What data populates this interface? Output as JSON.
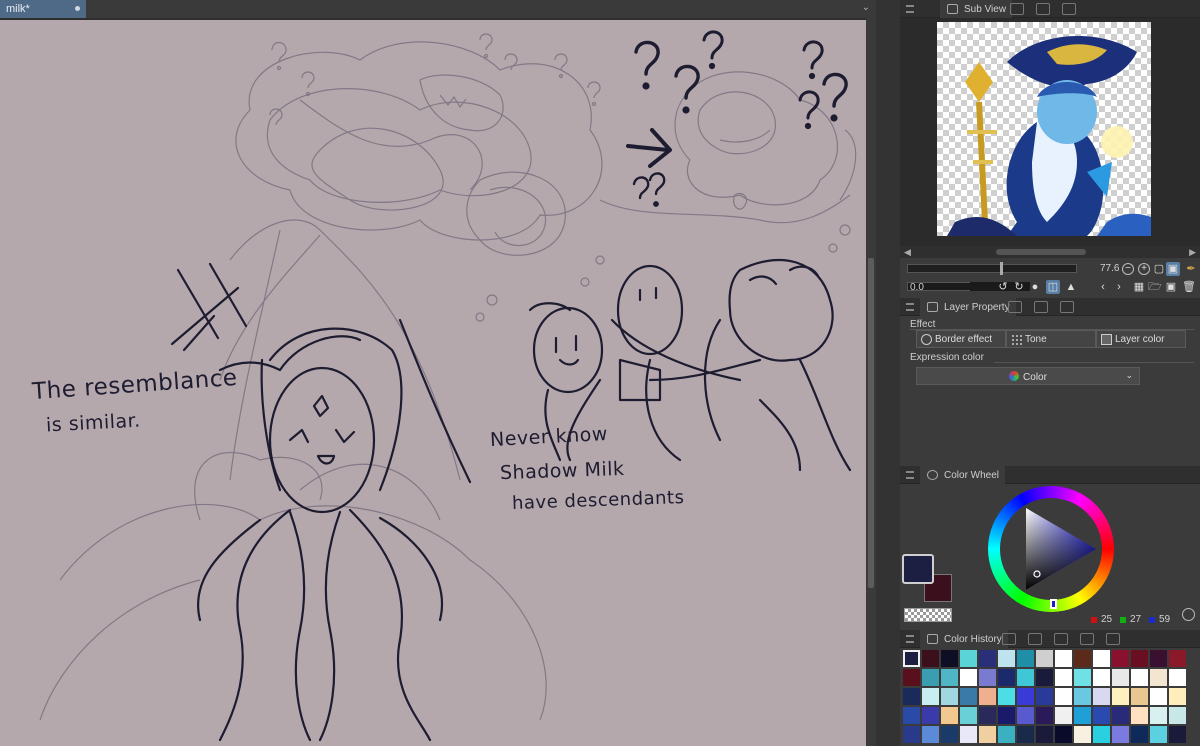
{
  "document": {
    "tab_title": "milk*"
  },
  "canvas": {
    "background": "#b5a8ad",
    "ink": "#1d1c30",
    "notes": {
      "left": [
        "The resemblance",
        "is similar."
      ],
      "right": [
        "Never know",
        "Shadow Milk",
        "have descendants"
      ]
    }
  },
  "panels": {
    "sub_view": {
      "tab_label": "Sub View",
      "zoom": "77.6",
      "angle": "0.0"
    },
    "layer_property": {
      "tab_label": "Layer Property",
      "effect_label": "Effect",
      "effects": [
        "Border effect",
        "Tone",
        "Layer color"
      ],
      "expression_label": "Expression color",
      "expression_value": "Color"
    },
    "color_wheel": {
      "tab_label": "Color Wheel",
      "main_color": "#1c1f42",
      "sub_color": "#3c0f1c",
      "r": "25",
      "g": "27",
      "b": "59"
    },
    "color_history": {
      "tab_label": "Color History",
      "colors": [
        "#1c1f42",
        "#3c0f1c",
        "#0e0f24",
        "#5bd4d8",
        "#2a2f7a",
        "#bfe3ee",
        "#1f8fa8",
        "#cfcfcf",
        "#ffffff",
        "#5c2a1a",
        "#ffffff",
        "#8a1030",
        "#6a0e22",
        "#3a1030",
        "#8a1a2a",
        "#5a0f1c",
        "#3a9db0",
        "#4fb6c6",
        "#ffffff",
        "#7a7ad0",
        "#1a2a6a",
        "#3fc7d7",
        "#1a1a3a",
        "#ffffff",
        "#6ee0e6",
        "#ffffff",
        "#e8e8e8",
        "#ffffff",
        "#f2e6d0",
        "#ffffff",
        "#1a2a5a",
        "#c8eef2",
        "#9fd8e0",
        "#3a7aa8",
        "#f0b090",
        "#4cdde6",
        "#3a3ad8",
        "#2a3a9a",
        "#ffffff",
        "#6ac8e0",
        "#d8d8f0",
        "#fff0c0",
        "#e8c890",
        "#ffffff",
        "#ffeebb",
        "#2a4aa8",
        "#3a3aaa",
        "#f0c890",
        "#6ad0d8",
        "#2a2a5a",
        "#1a1a6a",
        "#5a5ad0",
        "#2a1a5a",
        "#f0f0f0",
        "#1e9fd6",
        "#2a4ab0",
        "#2a2a7a",
        "#ffe0c0",
        "#d8f0f0",
        "#c8e8e8",
        "#2a3a8a",
        "#5a8ad8",
        "#1a3a6a",
        "#e8e8f8",
        "#f0d0a0",
        "#3ab0c0",
        "#1a2a4a",
        "#1a1a3a",
        "#0a0a2a",
        "#f8f0e0",
        "#2ad0e0",
        "#7a7ae0",
        "#0e2a5a",
        "#5ad0e0",
        "#1a1a3a"
      ]
    }
  }
}
